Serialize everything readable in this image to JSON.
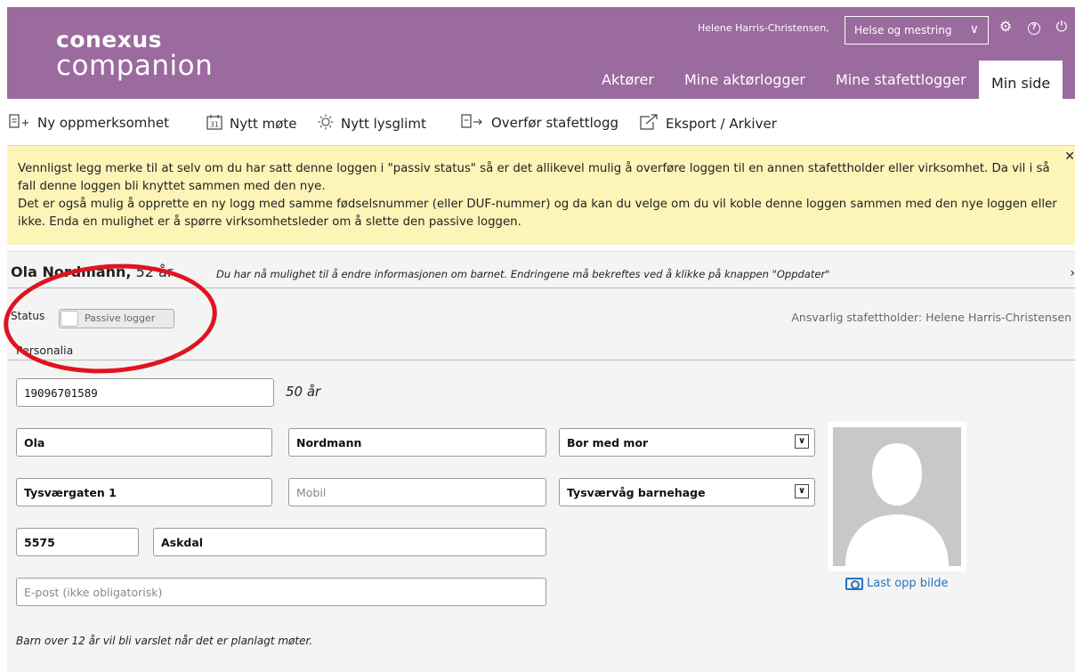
{
  "header": {
    "logo_top": "conexus",
    "logo_bottom": "companion",
    "user_name": "Helene Harris-Christensen,",
    "org_selected": "Helse og mestring",
    "nav_tabs": [
      {
        "label": "Aktører"
      },
      {
        "label": "Mine aktørlogger"
      },
      {
        "label": "Mine stafettlogger"
      },
      {
        "label": "Min side"
      }
    ]
  },
  "toolbar": {
    "items": [
      {
        "label": "Ny oppmerksomhet",
        "icon": "new-attention-icon"
      },
      {
        "label": "Nytt møte",
        "icon": "calendar-icon"
      },
      {
        "label": "Nytt lysglimt",
        "icon": "sun-icon"
      },
      {
        "label": "Overfør stafettlogg",
        "icon": "transfer-icon"
      },
      {
        "label": "Eksport / Arkiver",
        "icon": "export-icon"
      }
    ],
    "calendar_day": "31"
  },
  "notice": {
    "line1": "Vennligst legg merke til at selv om du har satt denne loggen i \"passiv status\" så er det allikevel mulig å overføre loggen til en annen stafettholder eller virksomhet. Da vil i så fall denne loggen bli knyttet sammen med den nye.",
    "line2": "Det er også mulig å opprette en ny logg med samme fødselsnummer (eller DUF-nummer) og da kan du velge om du vil koble denne loggen sammen med den nye loggen eller ikke. Enda en mulighet er å spørre virksomhetsleder om å slette den passive loggen."
  },
  "person": {
    "name": "Ola Nordmann,",
    "age_header": "52 år",
    "note": "Du har nå mulighet til å endre informasjonen om barnet. Endringene må bekreftes ved å klikke på knappen \"Oppdater\"",
    "status_label": "Status",
    "status_toggle": "Passive logger",
    "responsible": "Ansvarlig stafettholder: Helene Harris-Christensen",
    "section": "Personalia",
    "ssn": "19096701589",
    "age_field": "50 år",
    "first_name": "Ola",
    "last_name": "Nordmann",
    "living": "Bor med mor",
    "address": "Tysværgaten 1",
    "mobile_placeholder": "Mobil",
    "kindergarten": "Tysværvåg barnehage",
    "postal_code": "5575",
    "city": "Askdal",
    "email_placeholder": "E-post (ikke obligatorisk)",
    "upload_label": "Last opp bilde",
    "bottom_note": "Barn over 12 år vil bli varslet når det er planlagt møter."
  },
  "colors": {
    "header_bg": "#9b6a9e",
    "notice_bg": "#fdf4b8",
    "link": "#2a72b8",
    "annotation": "#e0141e"
  }
}
